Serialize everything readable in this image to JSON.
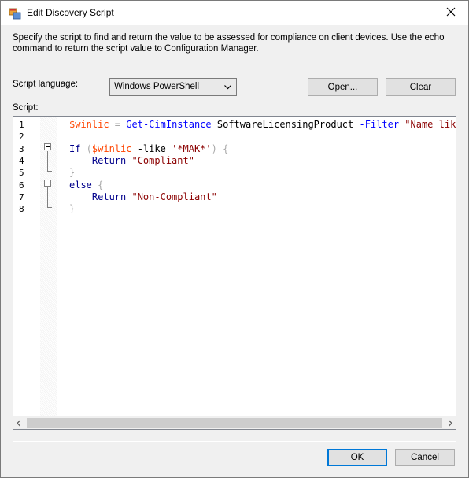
{
  "window": {
    "title": "Edit Discovery Script"
  },
  "description": "Specify the script to find and return the value to be assessed for compliance on client devices. Use the echo command to return the script value to Configuration Manager.",
  "script_language": {
    "label": "Script language:",
    "selected": "Windows PowerShell"
  },
  "buttons": {
    "open": "Open...",
    "clear": "Clear",
    "ok": "OK",
    "cancel": "Cancel"
  },
  "script_label": "Script:",
  "editor": {
    "line_numbers": [
      "1",
      "2",
      "3",
      "4",
      "5",
      "6",
      "7",
      "8"
    ],
    "lines": [
      [
        {
          "t": "$winlic",
          "c": "c-var"
        },
        {
          "t": " = ",
          "c": "c-op"
        },
        {
          "t": "Get-CimInstance",
          "c": "c-cmd"
        },
        {
          "t": " SoftwareLicensingProduct ",
          "c": "c-punct"
        },
        {
          "t": "-Filter",
          "c": "c-cmd"
        },
        {
          "t": " \"Name like 'Wi",
          "c": "c-str"
        }
      ],
      [],
      [
        {
          "t": "If",
          "c": "c-kw"
        },
        {
          "t": " (",
          "c": "c-op"
        },
        {
          "t": "$winlic",
          "c": "c-var"
        },
        {
          "t": " -like ",
          "c": "c-punct"
        },
        {
          "t": "'*MAK*'",
          "c": "c-str"
        },
        {
          "t": ") {",
          "c": "c-op"
        }
      ],
      [
        {
          "t": "    Return ",
          "c": "c-kw"
        },
        {
          "t": "\"Compliant\"",
          "c": "c-str"
        }
      ],
      [
        {
          "t": "}",
          "c": "c-op"
        }
      ],
      [
        {
          "t": "else",
          "c": "c-kw"
        },
        {
          "t": " {",
          "c": "c-op"
        }
      ],
      [
        {
          "t": "    Return ",
          "c": "c-kw"
        },
        {
          "t": "\"Non-Compliant\"",
          "c": "c-str"
        }
      ],
      [
        {
          "t": "}",
          "c": "c-op"
        }
      ]
    ]
  },
  "icons": {
    "app": "app-window-icon",
    "close": "close-icon",
    "dropdown": "chevron-down-icon",
    "scroll_left": "scroll-left-icon",
    "scroll_right": "scroll-right-icon",
    "fold": "fold-collapse-icon"
  },
  "colors": {
    "default_button_border": "#0078d7",
    "variable": "#ff4500",
    "cmdlet": "#0000ff",
    "keyword": "#00008b",
    "string": "#8b0000"
  }
}
